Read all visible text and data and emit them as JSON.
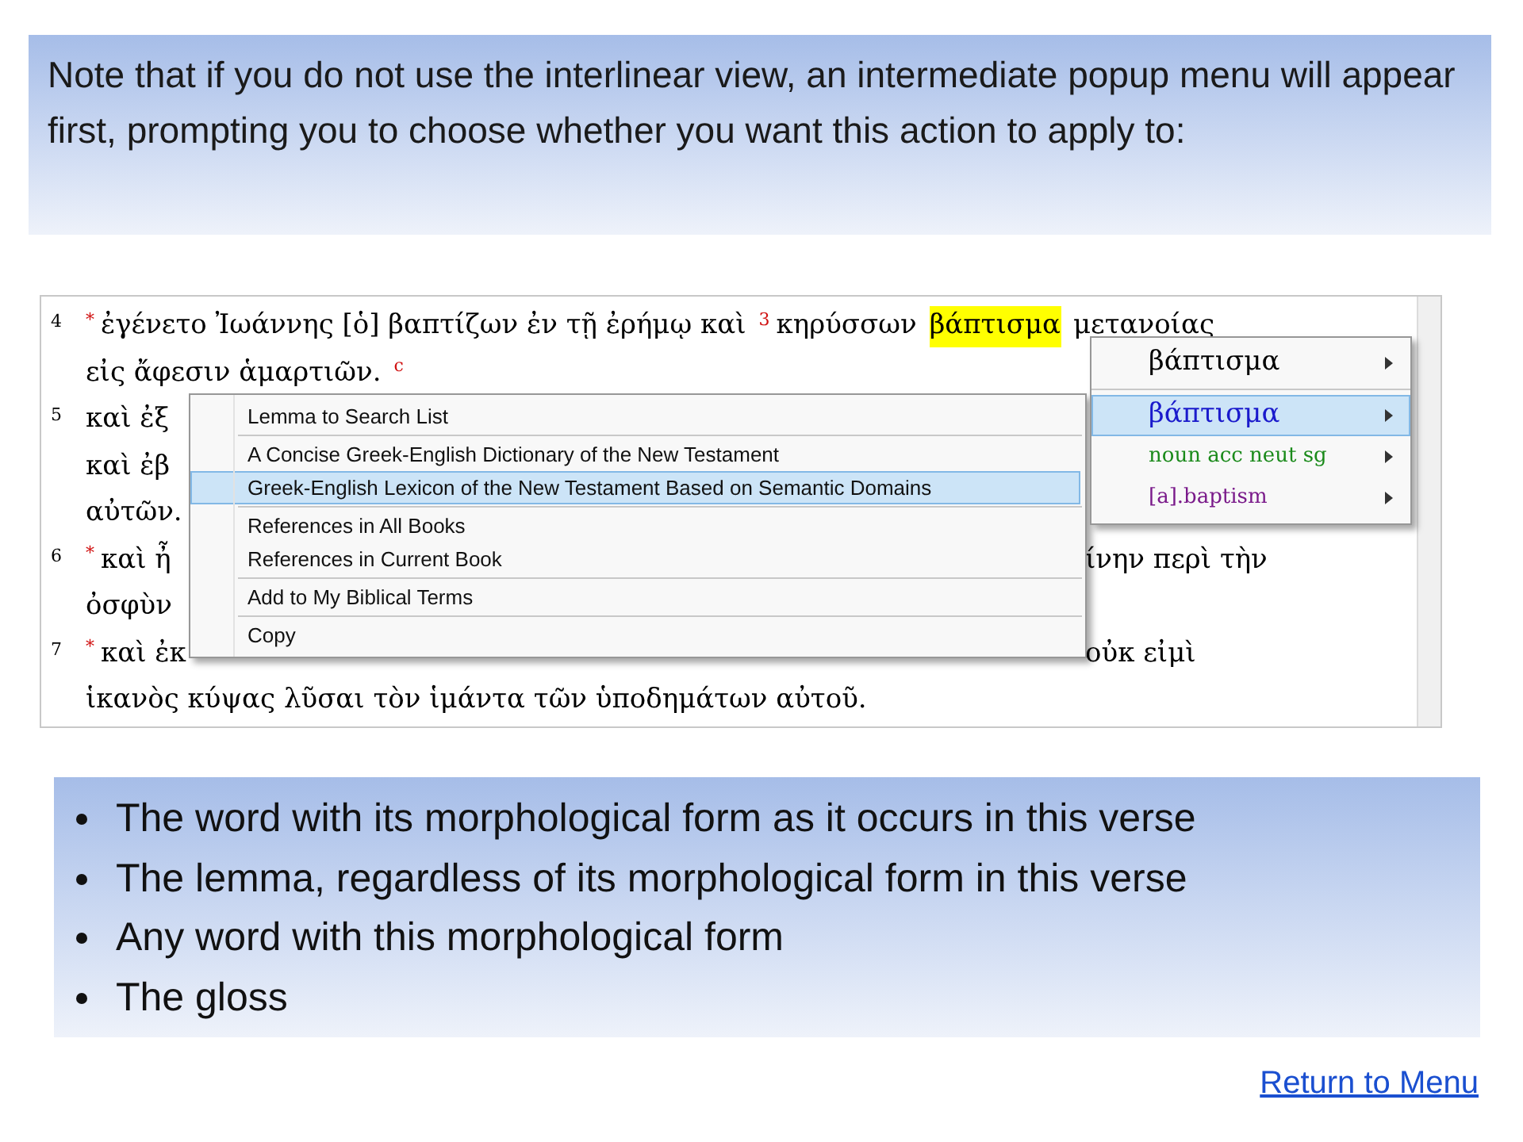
{
  "intro": "Note that if you do not use the interlinear view, an intermediate popup menu will appear first, prompting you to choose whether you want this action to apply to:",
  "panel": {
    "lines": [
      {
        "number": "4",
        "segments": [
          {
            "kind": "note",
            "text": "*"
          },
          {
            "kind": "word",
            "text": "ἐγένετο Ἰωάννης [ὁ] βαπτίζων ἐν τῇ ἐρήμῳ καὶ"
          },
          {
            "kind": "note",
            "text": "3"
          },
          {
            "kind": "word",
            "text": "κηρύσσων"
          },
          {
            "kind": "highlight",
            "text": "βάπτισμα"
          },
          {
            "kind": "word",
            "text": "μετανοίας"
          }
        ]
      },
      {
        "segments": [
          {
            "kind": "word",
            "text": "εἰς ἄφεσιν ἁμαρτιῶν."
          },
          {
            "kind": "note",
            "text": "c"
          }
        ]
      },
      {
        "number": "5",
        "segments": [
          {
            "kind": "word",
            "text": "καὶ ἐξ"
          }
        ]
      },
      {
        "segments": [
          {
            "kind": "word",
            "text": "καὶ ἐβ"
          }
        ]
      },
      {
        "segments": [
          {
            "kind": "word",
            "text": "αὐτῶν."
          }
        ]
      },
      {
        "number": "6",
        "segments": [
          {
            "kind": "note",
            "text": "*"
          },
          {
            "kind": "word",
            "text": "καὶ ἦ"
          }
        ],
        "tail": "ίνην περὶ τὴν"
      },
      {
        "segments": [
          {
            "kind": "word",
            "text": "ὀσφὺν"
          }
        ]
      },
      {
        "number": "7",
        "segments": [
          {
            "kind": "note",
            "text": "*"
          },
          {
            "kind": "word",
            "text": "καὶ ἐκ"
          }
        ],
        "tail": "οὐκ εἰμὶ"
      },
      {
        "segments": [
          {
            "kind": "word",
            "text": "ἱκανὸς κύψας λῦσαι τὸν ἱμάντα τῶν ὑποδημάτων αὐτοῦ."
          }
        ]
      }
    ],
    "context_menu": {
      "groups": [
        [
          {
            "label": "Lemma to Search List",
            "selected": false
          }
        ],
        [
          {
            "label": "A Concise Greek-English Dictionary of the New Testament",
            "selected": false
          },
          {
            "label": "Greek-English Lexicon of the New Testament Based on Semantic Domains",
            "selected": true
          }
        ],
        [
          {
            "label": "References in All Books",
            "selected": false
          },
          {
            "label": "References in Current Book",
            "selected": false
          }
        ],
        [
          {
            "label": "Add to My Biblical Terms",
            "selected": false
          }
        ],
        [
          {
            "label": "Copy",
            "selected": false
          }
        ]
      ]
    },
    "submenu": {
      "groups": [
        [
          {
            "label": "βάπτισμα",
            "color": "#000000",
            "greek": true,
            "selected": false
          }
        ],
        [
          {
            "label": "βάπτισμα",
            "color": "#1a1acc",
            "greek": true,
            "selected": true
          },
          {
            "label": "noun acc neut sg",
            "color": "#1a8a1a",
            "greek": false,
            "selected": false
          },
          {
            "label": "[a].baptism",
            "color": "#7a1a8a",
            "greek": false,
            "selected": false
          }
        ]
      ]
    }
  },
  "bullets": [
    "The word with its morphological form as it occurs in this verse",
    "The lemma, regardless of its morphological form in this verse",
    "Any word with this morphological form",
    "The gloss"
  ],
  "link": "Return to Menu"
}
